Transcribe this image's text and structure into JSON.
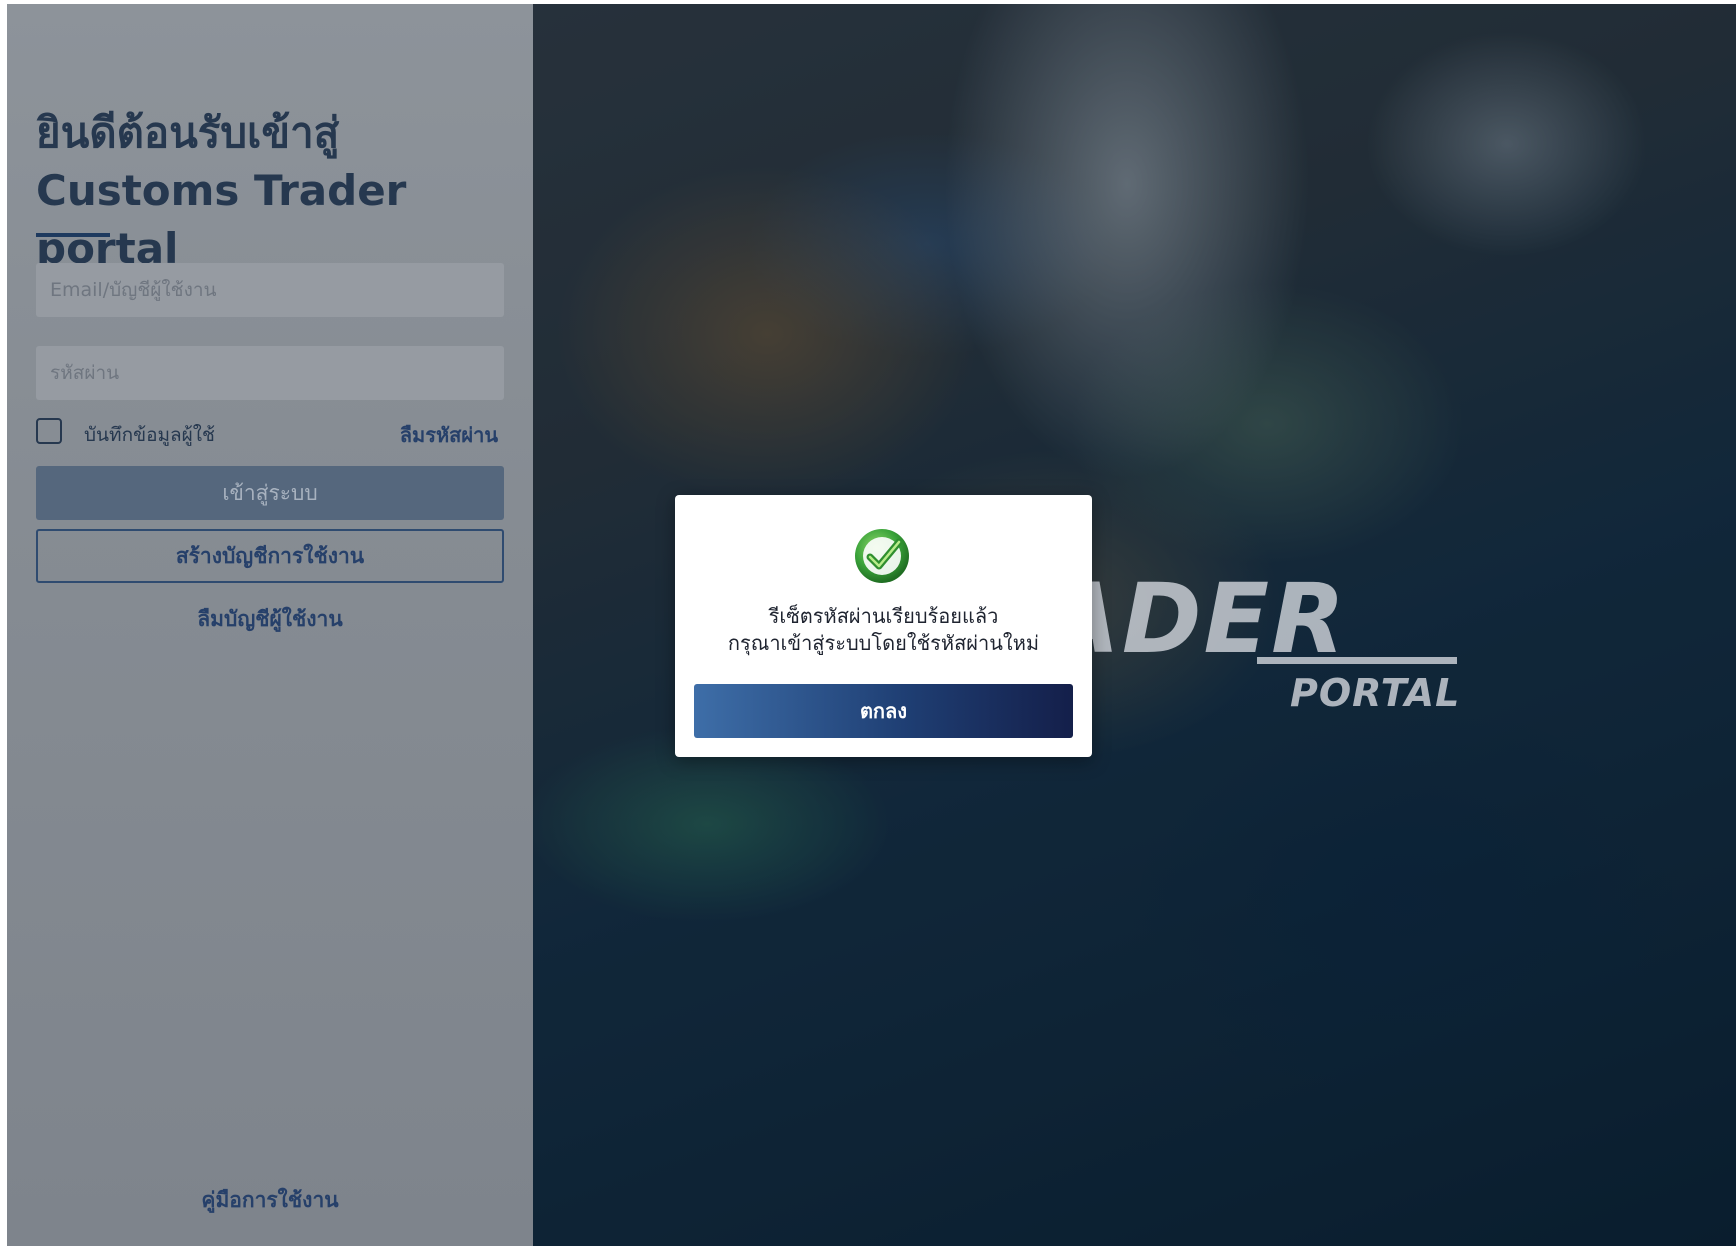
{
  "brand": {
    "word": "ADER",
    "sub": "PORTAL"
  },
  "login": {
    "welcome_line1": "ยินดีต้อนรับเข้าสู่",
    "welcome_line2": "Customs Trader portal",
    "email_placeholder": "Email/บัญชีผู้ใช้งาน",
    "password_placeholder": "รหัสผ่าน",
    "remember_label": "บันทึกข้อมูลผู้ใช้",
    "forgot_password": "ลืมรหัสผ่าน",
    "login_button": "เข้าสู่ระบบ",
    "register_button": "สร้างบัญชีการใช้งาน",
    "forgot_account": "ลืมบัญชีผู้ใช้งาน",
    "manual": "คู่มือการใช้งาน"
  },
  "modal": {
    "icon": "check-circle-icon",
    "message_line1": "รีเซ็ตรหัสผ่านเรียบร้อยแล้ว",
    "message_line2": "กรุณาเข้าสู่ระบบโดยใช้รหัสผ่านใหม่",
    "ok_button": "ตกลง"
  },
  "colors": {
    "primary": "#1f3f74",
    "accent": "#3e6ea8",
    "success": "#3aa33a"
  }
}
